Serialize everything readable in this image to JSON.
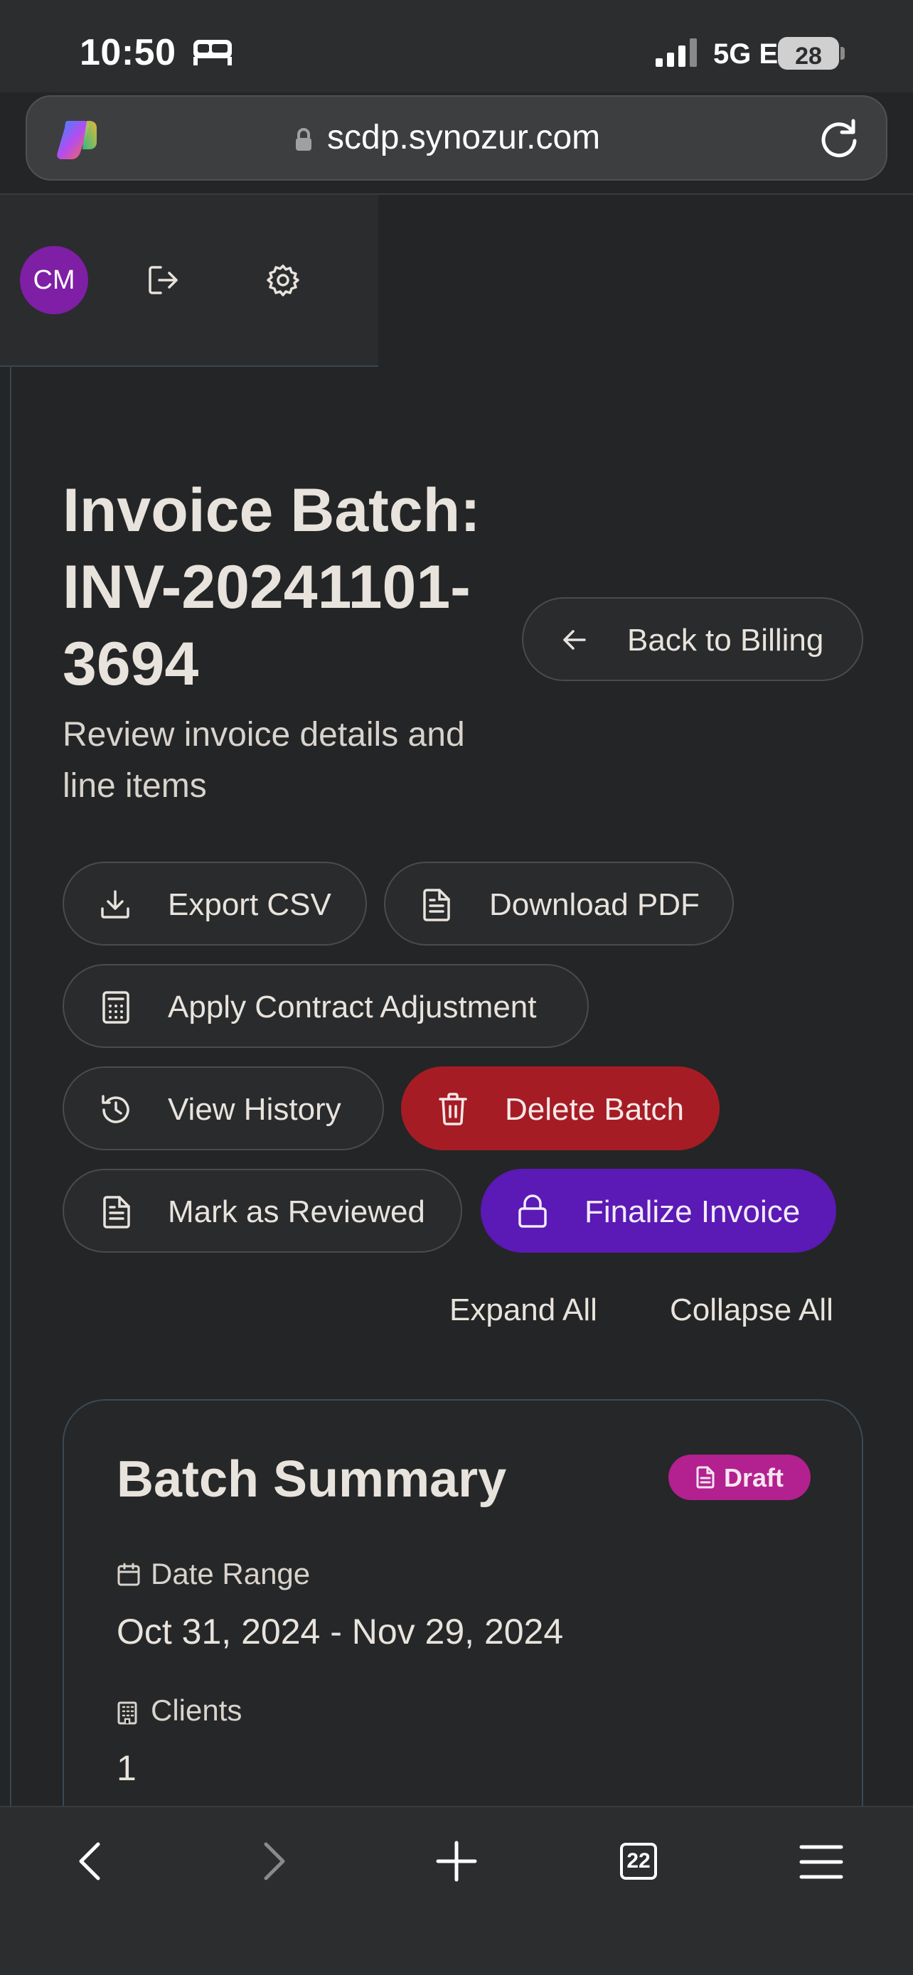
{
  "status_bar": {
    "time": "10:50",
    "network": "5G E",
    "battery": "28"
  },
  "browser": {
    "url": "scdp.synozur.com",
    "tab_count": "22"
  },
  "user": {
    "initials": "CM"
  },
  "page": {
    "title": "Invoice Batch: INV-20241101-3694",
    "subtitle": "Review invoice details and line items",
    "back_label": "Back to Billing"
  },
  "actions": {
    "export_csv": "Export CSV",
    "download_pdf": "Download PDF",
    "apply_adjustment": "Apply Contract Adjustment",
    "view_history": "View History",
    "delete_batch": "Delete Batch",
    "mark_reviewed": "Mark as Reviewed",
    "finalize": "Finalize Invoice",
    "expand_all": "Expand All",
    "collapse_all": "Collapse All"
  },
  "summary": {
    "title": "Batch Summary",
    "status": "Draft",
    "date_range_label": "Date Range",
    "date_range_value": "Oct 31, 2024 - Nov 29, 2024",
    "clients_label": "Clients",
    "clients_value": "1"
  },
  "colors": {
    "background": "#242526",
    "danger": "#a61c24",
    "primary": "#5b19b5",
    "badge_draft": "#b3208f",
    "avatar": "#7e1fa6"
  }
}
